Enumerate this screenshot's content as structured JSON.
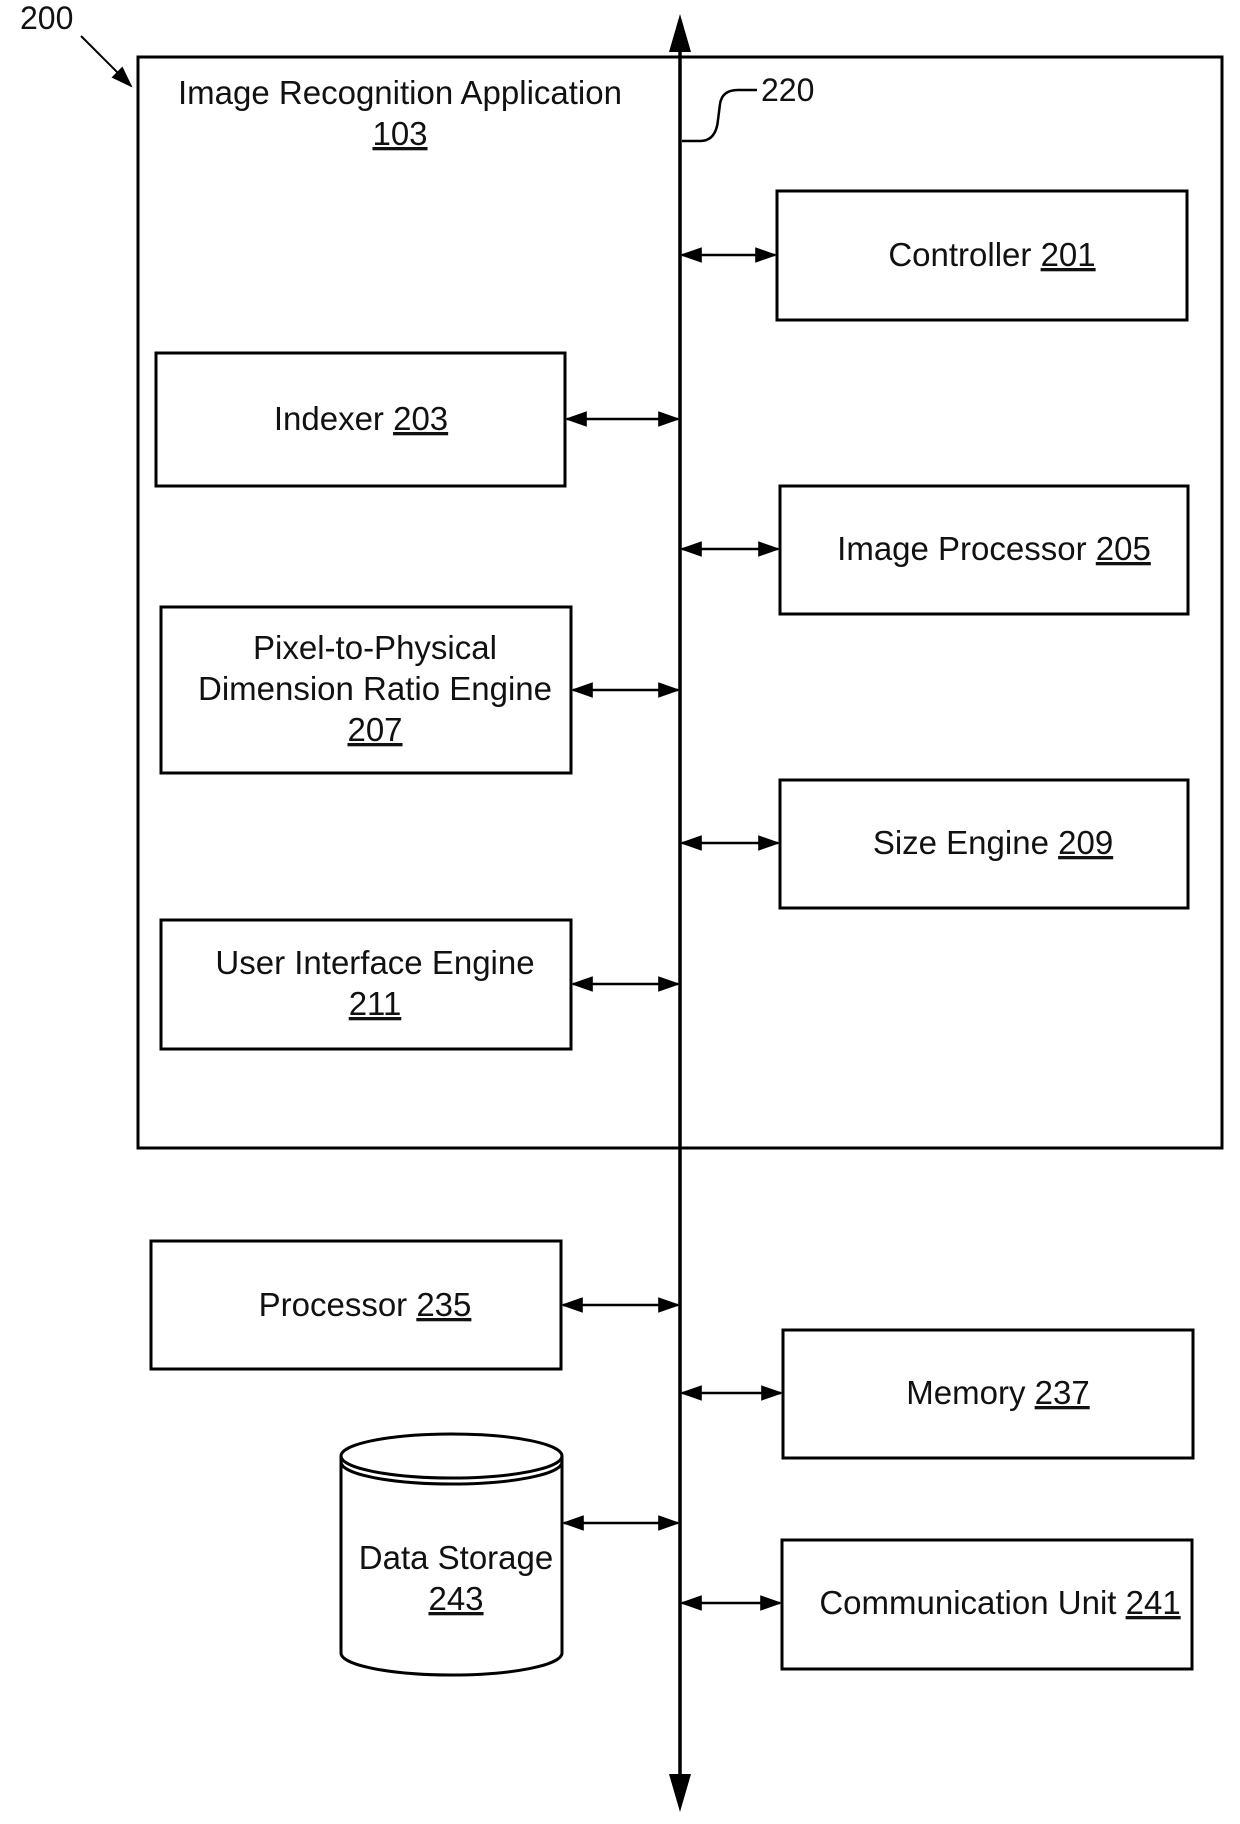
{
  "figure": {
    "figure_ref": "200",
    "bus_ref": "220",
    "application": {
      "title": "Image Recognition Application",
      "ref": "103"
    },
    "modules": [
      {
        "id": "controller",
        "lines": [
          "Controller"
        ],
        "ref": "201",
        "inline_ref": true
      },
      {
        "id": "indexer",
        "lines": [
          "Indexer"
        ],
        "ref": "203",
        "inline_ref": true
      },
      {
        "id": "image-processor",
        "lines": [
          "Image Processor"
        ],
        "ref": "205",
        "inline_ref": true
      },
      {
        "id": "pixel-ratio-engine",
        "lines": [
          "Pixel-to-Physical",
          "Dimension Ratio Engine"
        ],
        "ref": "207",
        "inline_ref": false
      },
      {
        "id": "size-engine",
        "lines": [
          "Size Engine"
        ],
        "ref": "209",
        "inline_ref": true
      },
      {
        "id": "ui-engine",
        "lines": [
          "User Interface Engine"
        ],
        "ref": "211",
        "inline_ref": false
      }
    ],
    "components": [
      {
        "id": "processor",
        "lines": [
          "Processor"
        ],
        "ref": "235",
        "inline_ref": true
      },
      {
        "id": "memory",
        "lines": [
          "Memory"
        ],
        "ref": "237",
        "inline_ref": true
      },
      {
        "id": "data-storage",
        "lines": [
          "Data Storage"
        ],
        "ref": "243",
        "inline_ref": false,
        "shape": "cylinder"
      },
      {
        "id": "communication-unit",
        "lines": [
          "Communication Unit"
        ],
        "ref": "241",
        "inline_ref": true
      }
    ]
  }
}
